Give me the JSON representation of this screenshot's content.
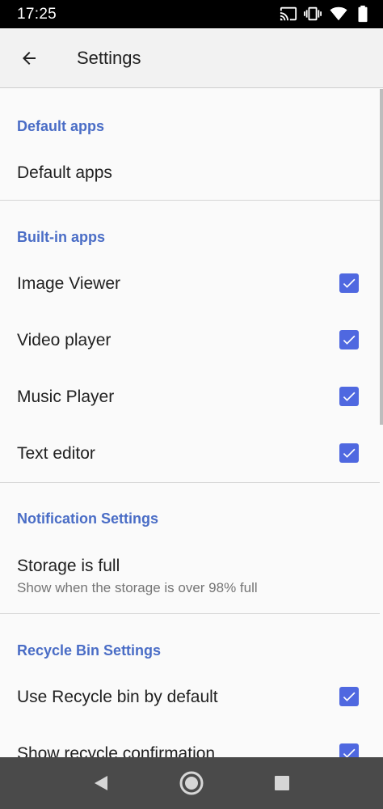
{
  "status_bar": {
    "time": "17:25",
    "icons": [
      "cast-icon",
      "vibrate-icon",
      "wifi-icon",
      "battery-icon"
    ]
  },
  "app_bar": {
    "title": "Settings",
    "back_icon": "arrow-back-icon"
  },
  "sections": {
    "default_apps": {
      "header": "Default apps",
      "item_title": "Default apps"
    },
    "built_in_apps": {
      "header": "Built-in apps",
      "items": [
        {
          "title": "Image Viewer",
          "checked": true
        },
        {
          "title": "Video player",
          "checked": true
        },
        {
          "title": "Music Player",
          "checked": true
        },
        {
          "title": "Text editor",
          "checked": true
        }
      ]
    },
    "notification_settings": {
      "header": "Notification Settings",
      "item_title": "Storage is full",
      "item_summary": "Show when the storage is over 98% full"
    },
    "recycle_bin_settings": {
      "header": "Recycle Bin Settings",
      "items": [
        {
          "title": "Use Recycle bin by default",
          "checked": true
        },
        {
          "title": "Show recycle confirmation",
          "checked": true
        }
      ]
    }
  },
  "nav_bar": {
    "icons": [
      "nav-back-icon",
      "nav-home-icon",
      "nav-recents-icon"
    ]
  },
  "colors": {
    "accent": "#4a6dc6",
    "checkbox": "#4f68e0",
    "status_bar": "#000000",
    "nav_bar": "#4a4a4a",
    "app_bar": "#f2f2f2"
  }
}
